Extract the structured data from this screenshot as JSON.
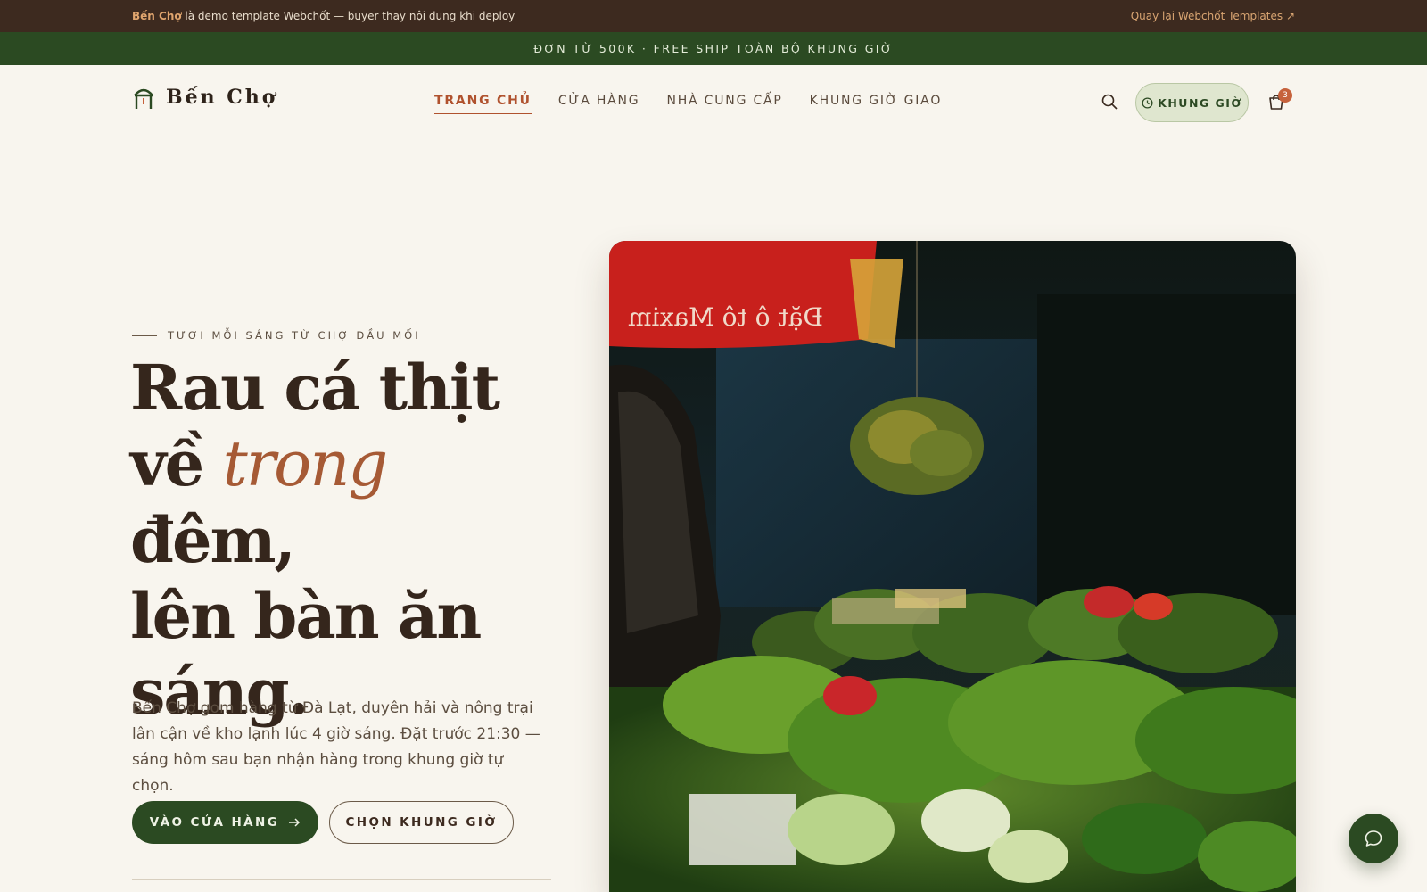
{
  "topbar": {
    "brand": "Bến Chợ",
    "notice": " là demo template Webchốt — buyer thay nội dung khi deploy",
    "back_link": "Quay lại Webchốt Templates ↗"
  },
  "promo": {
    "text": "ĐƠN TỪ 500K · FREE SHIP TOÀN BỘ KHUNG GIỜ"
  },
  "header": {
    "logo_text": "Bến Chợ",
    "nav": [
      {
        "label": "TRANG CHỦ",
        "active": true
      },
      {
        "label": "CỬA HÀNG"
      },
      {
        "label": "NHÀ CUNG CẤP"
      },
      {
        "label": "KHUNG GIỜ GIAO"
      }
    ],
    "slot_button": "KHUNG GIỜ",
    "cart_count": "3",
    "icons": [
      "search-icon",
      "clock-icon",
      "cart-icon"
    ]
  },
  "hero": {
    "eyebrow": "TƯƠI MỖI SÁNG TỪ CHỢ ĐẦU MỐI",
    "headline_line1": "Rau cá thịt",
    "headline_l2_pre": "về ",
    "headline_l2_accent": "trong",
    "headline_l2_post": " đêm,",
    "headline_line3": "lên bàn ăn",
    "headline_line4": "sáng.",
    "description": "Bến Chợ gom hàng từ Đà Lạt, duyên hải và nông trại lân cận về kho lạnh lúc 4 giờ sáng. Đặt trước 21:30 — sáng hôm sau bạn nhận hàng trong khung giờ tự chọn.",
    "primary_cta": "VÀO CỬA HÀNG",
    "secondary_cta": "CHỌN KHUNG GIỜ",
    "image_sign_text": "Đặt ô tô Maxim"
  },
  "colors": {
    "topbar_bg": "#3d2a1f",
    "promo_bg": "#2b4a22",
    "page_bg": "#f8f5ee",
    "accent": "#b0522e",
    "primary_green": "#2b4a22"
  },
  "chat": {
    "icon": "chat-bubble-icon"
  }
}
